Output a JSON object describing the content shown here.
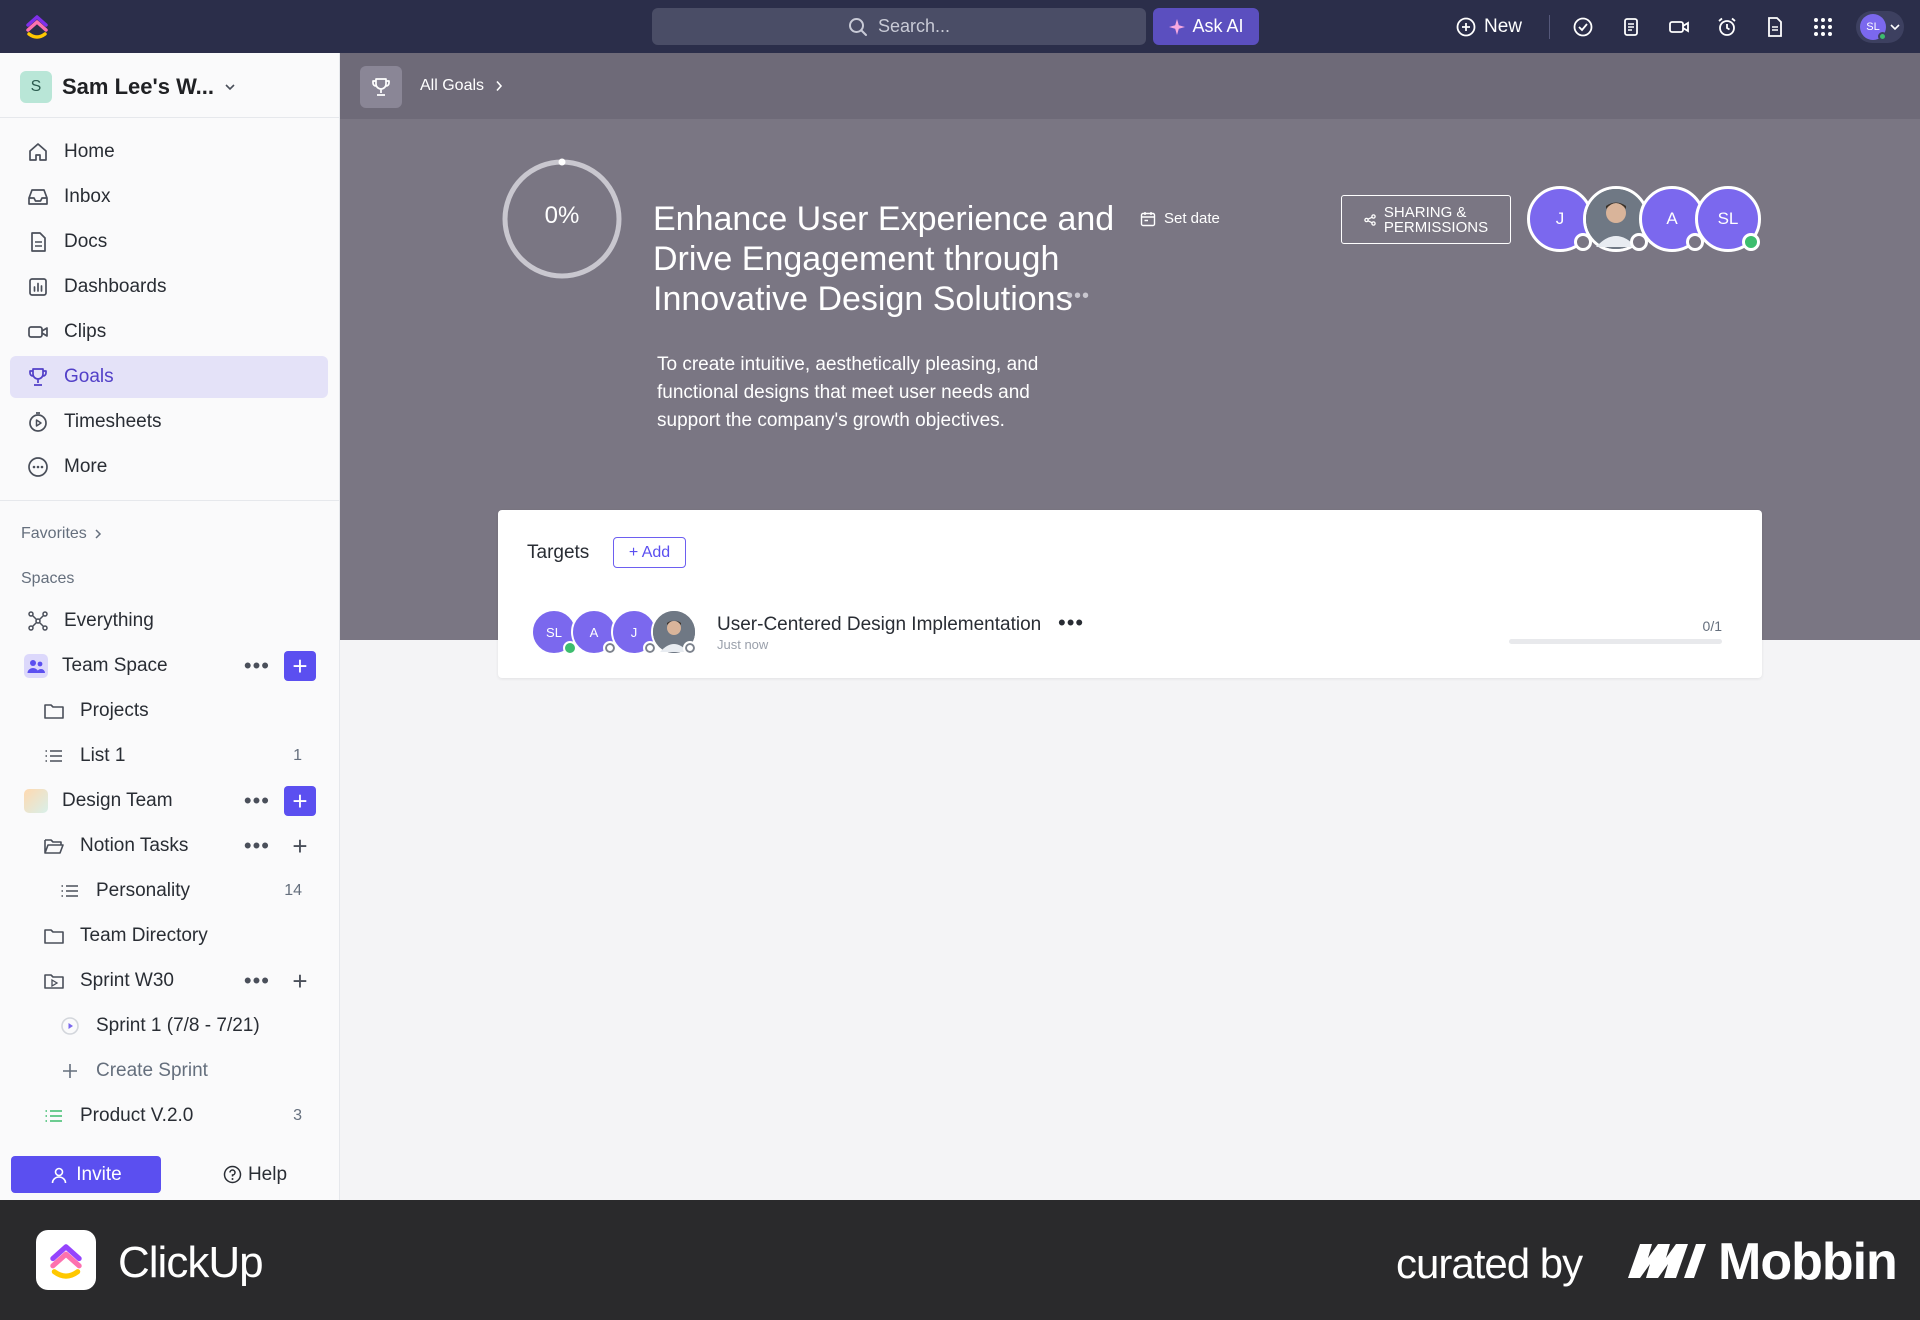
{
  "topbar": {
    "search_placeholder": "Search...",
    "ask_ai_label": "Ask AI",
    "new_label": "New",
    "user_initials": "SL"
  },
  "sidebar": {
    "workspace_initial": "S",
    "workspace_name": "Sam Lee's W...",
    "nav": [
      {
        "label": "Home",
        "icon": "home-icon"
      },
      {
        "label": "Inbox",
        "icon": "inbox-icon"
      },
      {
        "label": "Docs",
        "icon": "docs-icon"
      },
      {
        "label": "Dashboards",
        "icon": "dashboards-icon"
      },
      {
        "label": "Clips",
        "icon": "clips-icon"
      },
      {
        "label": "Goals",
        "icon": "trophy-icon",
        "active": true
      },
      {
        "label": "Timesheets",
        "icon": "timesheets-icon"
      },
      {
        "label": "More",
        "icon": "more-icon"
      }
    ],
    "favorites_label": "Favorites",
    "spaces_label": "Spaces",
    "tree": [
      {
        "label": "Everything",
        "count": ""
      },
      {
        "label": "Team Space",
        "count": ""
      },
      {
        "label": "Projects",
        "count": ""
      },
      {
        "label": "List 1",
        "count": "1"
      },
      {
        "label": "Design Team",
        "count": ""
      },
      {
        "label": "Notion Tasks",
        "count": ""
      },
      {
        "label": "Personality",
        "count": "14"
      },
      {
        "label": "Team Directory",
        "count": ""
      },
      {
        "label": "Sprint W30",
        "count": ""
      },
      {
        "label": "Sprint 1 (7/8 - 7/21)",
        "count": ""
      },
      {
        "label": "Create Sprint",
        "count": ""
      },
      {
        "label": "Product V.2.0",
        "count": "3"
      }
    ],
    "invite_label": "Invite",
    "help_label": "Help"
  },
  "goal": {
    "breadcrumb": "All Goals",
    "progress_text": "0%",
    "progress": 0,
    "title": "Enhance User Experience and Drive Engagement through Innovative Design Solutions",
    "set_date_label": "Set date",
    "sharing_line1": "SHARING &",
    "sharing_line2": "PERMISSIONS",
    "members": [
      "J",
      "",
      "A",
      "SL"
    ],
    "description": "To create intuitive, aesthetically pleasing, and functional designs that meet user needs and support the company's growth objectives."
  },
  "targets": {
    "title": "Targets",
    "add_label": "+ Add",
    "items": [
      {
        "name": "User-Centered Design Implementation",
        "time": "Just now",
        "count": "0/1",
        "progress": 0,
        "avatars": [
          "SL",
          "A",
          "J",
          ""
        ]
      }
    ]
  },
  "footer": {
    "app_name": "ClickUp",
    "curated_by": "curated by",
    "brand": "Mobbin"
  },
  "colors": {
    "accent": "#5b4ff0",
    "topbar": "#2b2e4a",
    "header": "#7a7683"
  }
}
